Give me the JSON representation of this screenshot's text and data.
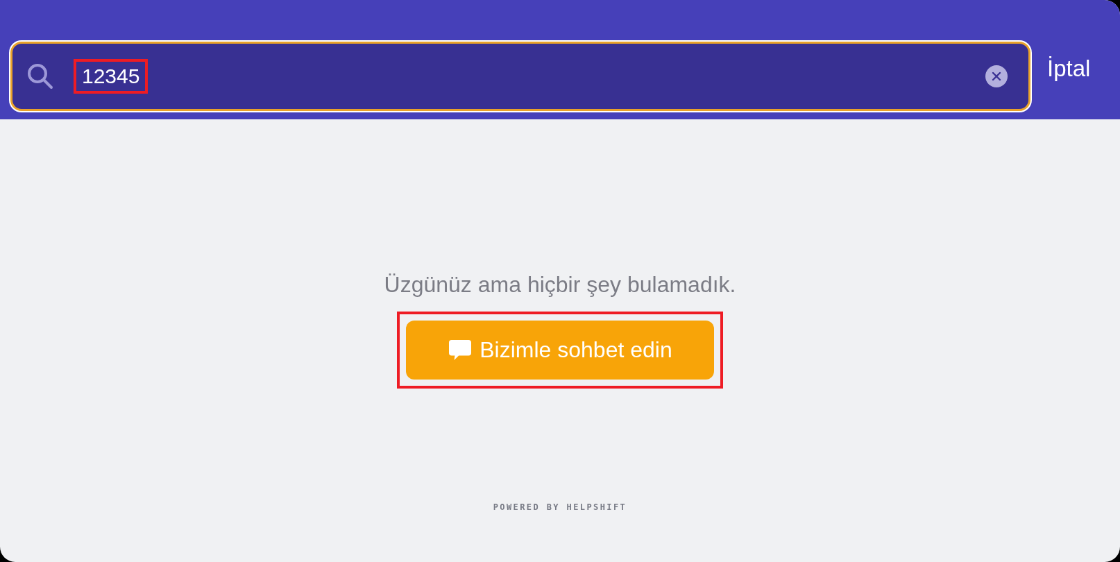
{
  "search": {
    "value": "12345",
    "highlighted": true
  },
  "cancel": "İptal",
  "empty_message": "Üzgünüz ama hiçbir şey bulamadık.",
  "chat_button": {
    "label": "Bizimle sohbet edin",
    "highlighted": true
  },
  "footer": "POWERED BY HELPSHIFT"
}
